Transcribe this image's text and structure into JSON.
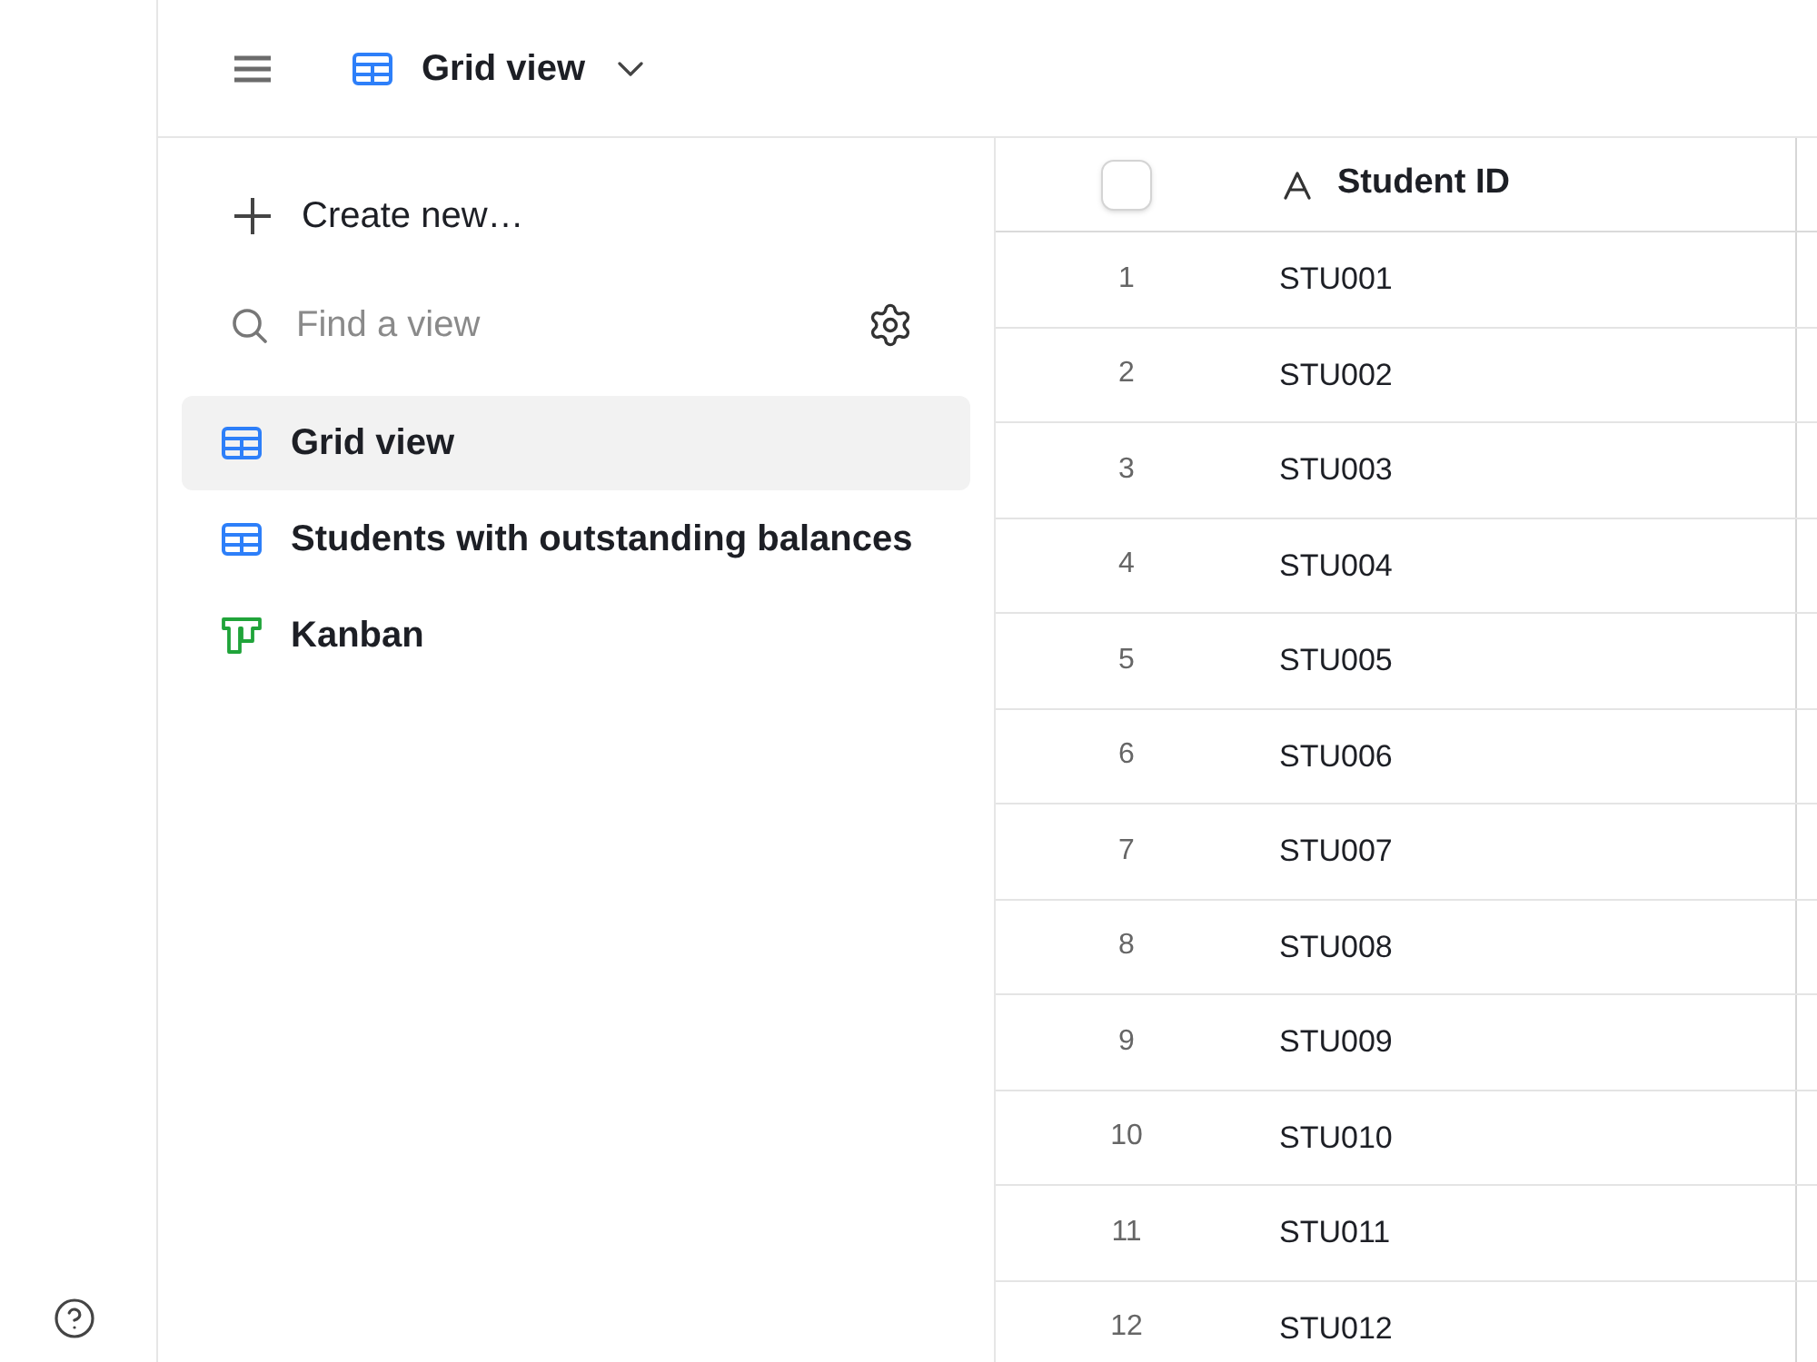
{
  "toolbar": {
    "view_name": "Grid view"
  },
  "sidebar": {
    "create_label": "Create new…",
    "search": {
      "placeholder": "Find a view"
    },
    "views": [
      {
        "label": "Grid view",
        "kind": "grid",
        "selected": true
      },
      {
        "label": "Students with outstanding balances",
        "kind": "grid",
        "selected": false
      },
      {
        "label": "Kanban",
        "kind": "kanban",
        "selected": false
      }
    ]
  },
  "table": {
    "header_checkbox": {
      "checked": false
    },
    "columns": [
      {
        "label": "Student ID",
        "kind": "text"
      }
    ],
    "rows": [
      {
        "number": "1",
        "cells": [
          "STU001"
        ]
      },
      {
        "number": "2",
        "cells": [
          "STU002"
        ]
      },
      {
        "number": "3",
        "cells": [
          "STU003"
        ]
      },
      {
        "number": "4",
        "cells": [
          "STU004"
        ]
      },
      {
        "number": "5",
        "cells": [
          "STU005"
        ]
      },
      {
        "number": "6",
        "cells": [
          "STU006"
        ]
      },
      {
        "number": "7",
        "cells": [
          "STU007"
        ]
      },
      {
        "number": "8",
        "cells": [
          "STU008"
        ]
      },
      {
        "number": "9",
        "cells": [
          "STU009"
        ]
      },
      {
        "number": "10",
        "cells": [
          "STU010"
        ]
      },
      {
        "number": "11",
        "cells": [
          "STU011"
        ]
      },
      {
        "number": "12",
        "cells": [
          "STU012"
        ]
      }
    ]
  }
}
